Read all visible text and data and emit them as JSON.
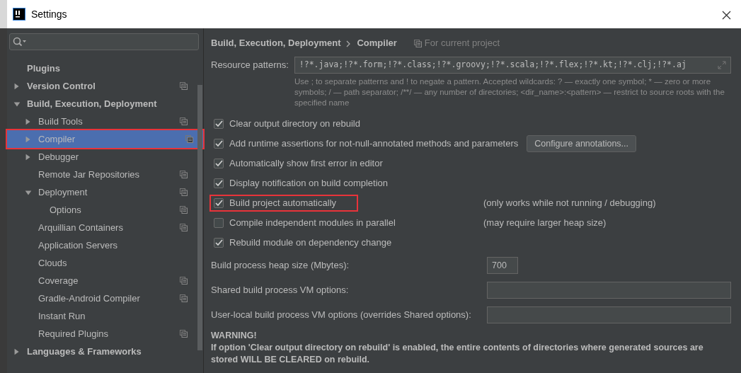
{
  "window": {
    "title": "Settings"
  },
  "sidebar": {
    "tree": [
      {
        "label": "Plugins",
        "selected": false,
        "shared": false
      },
      {
        "label": "Version Control",
        "expanded": false,
        "selected": false,
        "shared": true
      },
      {
        "label": "Build, Execution, Deployment",
        "expanded": true,
        "selected": false,
        "shared": false,
        "children": [
          {
            "label": "Build Tools",
            "expanded": false,
            "selected": false,
            "shared": true
          },
          {
            "label": "Compiler",
            "expanded": false,
            "selected": true,
            "shared": true,
            "annotated": true
          },
          {
            "label": "Debugger",
            "expanded": false,
            "selected": false,
            "shared": false
          },
          {
            "label": "Remote Jar Repositories",
            "selected": false,
            "shared": true
          },
          {
            "label": "Deployment",
            "expanded": true,
            "selected": false,
            "shared": true,
            "children": [
              {
                "label": "Options",
                "selected": false,
                "shared": true
              }
            ]
          },
          {
            "label": "Arquillian Containers",
            "selected": false,
            "shared": true
          },
          {
            "label": "Application Servers",
            "selected": false,
            "shared": false
          },
          {
            "label": "Clouds",
            "selected": false,
            "shared": false
          },
          {
            "label": "Coverage",
            "selected": false,
            "shared": true
          },
          {
            "label": "Gradle-Android Compiler",
            "selected": false,
            "shared": true
          },
          {
            "label": "Instant Run",
            "selected": false,
            "shared": false
          },
          {
            "label": "Required Plugins",
            "selected": false,
            "shared": true
          }
        ]
      },
      {
        "label": "Languages & Frameworks",
        "expanded": false,
        "selected": false,
        "shared": false
      }
    ]
  },
  "breadcrumb": [
    "Build, Execution, Deployment",
    "Compiler"
  ],
  "scope_note": "For current project",
  "resource_patterns": {
    "label": "Resource patterns:",
    "value": "!?*.java;!?*.form;!?*.class;!?*.groovy;!?*.scala;!?*.flex;!?*.kt;!?*.clj;!?*.aj",
    "help": "Use ; to separate patterns and ! to negate a pattern. Accepted wildcards: ? — exactly one symbol; * — zero or more symbols; / — path separator; /**/ — any number of directories;  <dir_name>:<pattern> — restrict to source roots with the specified name"
  },
  "options": [
    {
      "label": "Clear output directory on rebuild",
      "checked": true
    },
    {
      "label": "Add runtime assertions for not-null-annotated methods and parameters",
      "checked": true,
      "button": "Configure annotations..."
    },
    {
      "label": "Automatically show first error in editor",
      "checked": true
    },
    {
      "label": "Display notification on build completion",
      "checked": true
    },
    {
      "label": "Build project automatically",
      "checked": true,
      "note": "(only works while not running / debugging)",
      "annotated": true
    },
    {
      "label": "Compile independent modules in parallel",
      "checked": false,
      "note": "(may require larger heap size)"
    },
    {
      "label": "Rebuild module on dependency change",
      "checked": true
    }
  ],
  "fields": [
    {
      "label": "Build process heap size (Mbytes):",
      "value": "700",
      "kind": "short"
    },
    {
      "label": "Shared build process VM options:",
      "kind": "wide"
    },
    {
      "label": "User-local build process VM options (overrides Shared options):",
      "kind": "wide"
    }
  ],
  "warning": {
    "title": "WARNING!",
    "text": "If option 'Clear output directory on rebuild' is enabled, the entire contents of directories where generated sources are stored WILL BE CLEARED on rebuild."
  }
}
